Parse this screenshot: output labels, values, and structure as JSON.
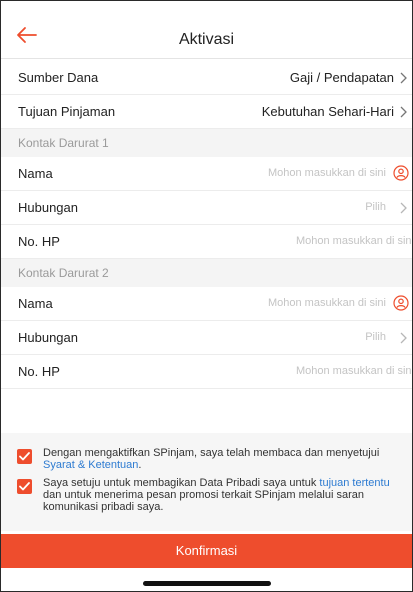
{
  "header": {
    "title": "Aktivasi"
  },
  "fund": {
    "sumber_label": "Sumber Dana",
    "sumber_value": "Gaji / Pendapatan",
    "tujuan_label": "Tujuan Pinjaman",
    "tujuan_value": "Kebutuhan Sehari-Hari"
  },
  "contact1": {
    "heading": "Kontak Darurat 1",
    "name_label": "Nama",
    "name_placeholder": "Mohon masukkan di sini",
    "relation_label": "Hubungan",
    "relation_placeholder": "Pilih",
    "phone_label": "No. HP",
    "phone_placeholder": "Mohon masukkan di sini"
  },
  "contact2": {
    "heading": "Kontak Darurat 2",
    "name_label": "Nama",
    "name_placeholder": "Mohon masukkan di sini",
    "relation_label": "Hubungan",
    "relation_placeholder": "Pilih",
    "phone_label": "No. HP",
    "phone_placeholder": "Mohon masukkan di sini"
  },
  "consent1": {
    "text_before": "Dengan mengaktifkan SPinjam, saya telah membaca dan menyetujui ",
    "link": "Syarat & Ketentuan",
    "text_after": "."
  },
  "consent2": {
    "text_before": "Saya setuju untuk membagikan Data Pribadi saya untuk ",
    "link": "tujuan tertentu",
    "text_after": " dan untuk menerima pesan promosi terkait SPinjam melalui saran komunikasi pribadi saya."
  },
  "confirm_label": "Konfirmasi",
  "colors": {
    "accent": "#ee4d2d",
    "link": "#2d7bd1"
  },
  "icons": {
    "back": "arrow-left-icon",
    "chevron": "chevron-right-icon",
    "contact": "contact-book-icon",
    "check": "checkmark-icon"
  }
}
